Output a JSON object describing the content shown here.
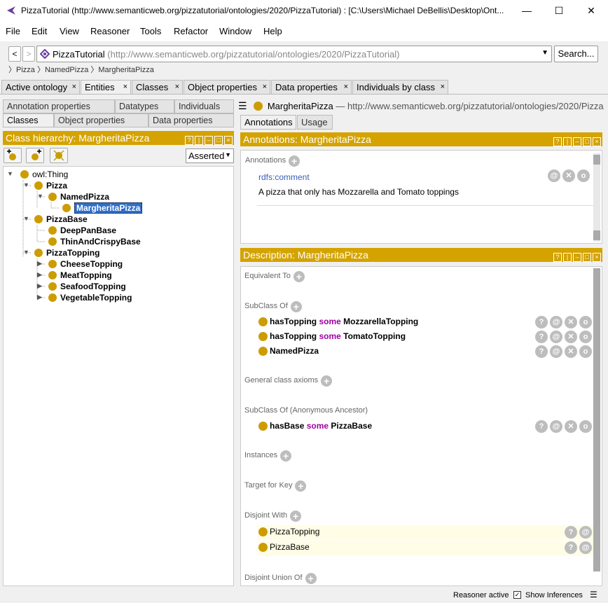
{
  "window": {
    "title": "PizzaTutorial (http://www.semanticweb.org/pizzatutorial/ontologies/2020/PizzaTutorial)  : [C:\\Users\\Michael DeBellis\\Desktop\\Ont...",
    "minimize": "—",
    "maximize": "☐",
    "close": "✕"
  },
  "menu": [
    "File",
    "Edit",
    "View",
    "Reasoner",
    "Tools",
    "Refactor",
    "Window",
    "Help"
  ],
  "nav": {
    "back": "<",
    "forward": ">",
    "ontology_name": "PizzaTutorial",
    "ontology_uri": "(http://www.semanticweb.org/pizzatutorial/ontologies/2020/PizzaTutorial)",
    "search": "Search...",
    "breadcrumbs": [
      "Pizza",
      "NamedPizza",
      "MargheritaPizza"
    ]
  },
  "tabs": [
    "Active ontology",
    "Entities",
    "Classes",
    "Object properties",
    "Data properties",
    "Individuals by class"
  ],
  "left": {
    "subtabs_row1": [
      "Annotation properties",
      "Datatypes",
      "Individuals"
    ],
    "subtabs_row2": [
      "Classes",
      "Object properties",
      "Data properties"
    ],
    "header": "Class hierarchy: MargheritaPizza",
    "asserted": "Asserted",
    "tree": [
      "owl:Thing",
      "Pizza",
      "NamedPizza",
      "MargheritaPizza",
      "PizzaBase",
      "DeepPanBase",
      "ThinAndCrispyBase",
      "PizzaTopping",
      "CheeseTopping",
      "MeatTopping",
      "SeafoodTopping",
      "VegetableTopping"
    ]
  },
  "right": {
    "entity_name": "MargheritaPizza",
    "entity_uri": "— http://www.semanticweb.org/pizzatutorial/ontologies/2020/Pizza",
    "tabs": [
      "Annotations",
      "Usage"
    ],
    "annotations_header": "Annotations: MargheritaPizza",
    "annotations_label": "Annotations",
    "comment_prop": "rdfs:comment",
    "comment_text": "A pizza that only has Mozzarella and Tomato toppings",
    "description_header": "Description: MargheritaPizza",
    "sections": {
      "equivalent": "Equivalent To",
      "subclass": "SubClass Of",
      "gca": "General class axioms",
      "anon": "SubClass Of (Anonymous Ancestor)",
      "instances": "Instances",
      "key": "Target for Key",
      "disjoint": "Disjoint With",
      "disjoint_union": "Disjoint Union Of"
    },
    "subclass_rows": [
      {
        "prop": "hasTopping",
        "kw": "some",
        "cls": "MozzarellaTopping"
      },
      {
        "prop": "hasTopping",
        "kw": "some",
        "cls": "TomatoTopping"
      },
      {
        "prop": "",
        "kw": "",
        "cls": "NamedPizza"
      }
    ],
    "anon_row": {
      "prop": "hasBase",
      "kw": "some",
      "cls": "PizzaBase"
    },
    "disjoint_rows": [
      "PizzaTopping",
      "PizzaBase"
    ]
  },
  "status": {
    "reasoner": "Reasoner active",
    "inferences": "Show Inferences"
  },
  "colors": {
    "gold": "#d4a300",
    "keyword": "#a000a0",
    "selection": "#2f6fc9"
  }
}
